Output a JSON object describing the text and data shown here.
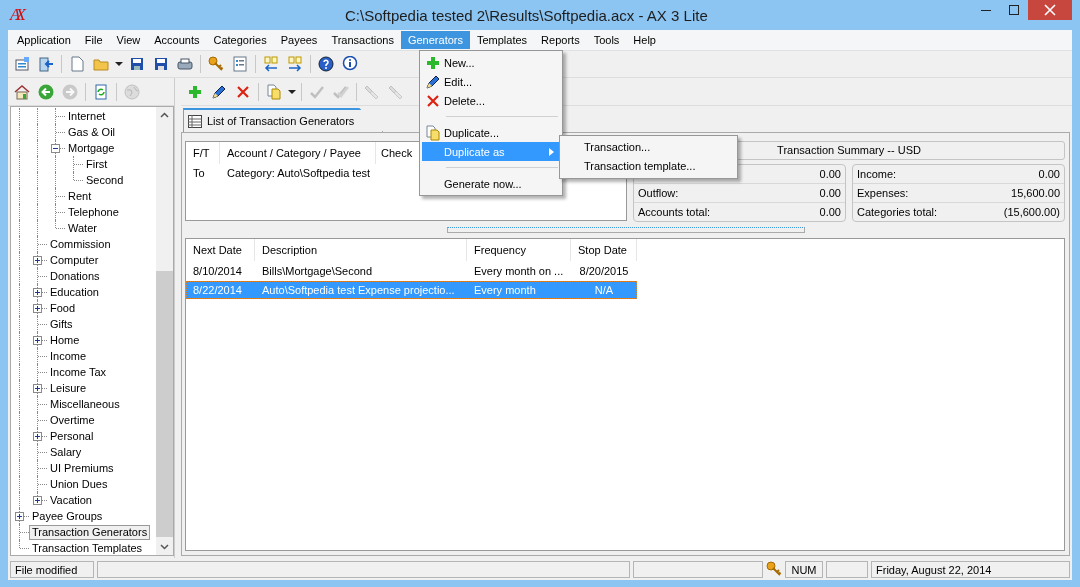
{
  "window": {
    "logo": "AX",
    "title": "C:\\Softpedia tested 2\\Results\\Softpedia.acx - AX 3 Lite"
  },
  "menu_bar": [
    {
      "label": "Application",
      "selected": false
    },
    {
      "label": "File",
      "selected": false
    },
    {
      "label": "View",
      "selected": false
    },
    {
      "label": "Accounts",
      "selected": false
    },
    {
      "label": "Categories",
      "selected": false
    },
    {
      "label": "Payees",
      "selected": false
    },
    {
      "label": "Transactions",
      "selected": false
    },
    {
      "label": "Generators",
      "selected": true
    },
    {
      "label": "Templates",
      "selected": false
    },
    {
      "label": "Reports",
      "selected": false
    },
    {
      "label": "Tools",
      "selected": false
    },
    {
      "label": "Help",
      "selected": false
    }
  ],
  "main_toolbar": [
    {
      "kind": "properties",
      "disabled": false
    },
    {
      "kind": "exit",
      "disabled": false
    },
    {
      "kind": "sep"
    },
    {
      "kind": "new",
      "disabled": false
    },
    {
      "kind": "open",
      "disabled": false
    },
    {
      "kind": "dropdown",
      "disabled": false
    },
    {
      "kind": "save",
      "disabled": false
    },
    {
      "kind": "saveas",
      "disabled": false
    },
    {
      "kind": "print",
      "disabled": false
    },
    {
      "kind": "sep"
    },
    {
      "kind": "key",
      "disabled": false
    },
    {
      "kind": "list",
      "disabled": false
    },
    {
      "kind": "sep"
    },
    {
      "kind": "moveleft",
      "disabled": false
    },
    {
      "kind": "moveright",
      "disabled": false
    },
    {
      "kind": "sep"
    },
    {
      "kind": "help",
      "disabled": false
    },
    {
      "kind": "info",
      "disabled": false
    }
  ],
  "nav_toolbar": [
    {
      "kind": "home",
      "disabled": false
    },
    {
      "kind": "back",
      "disabled": false
    },
    {
      "kind": "forward",
      "disabled": true
    },
    {
      "kind": "sep"
    },
    {
      "kind": "refresh",
      "disabled": false
    },
    {
      "kind": "sep"
    },
    {
      "kind": "globe",
      "disabled": true
    }
  ],
  "edit_toolbar": [
    {
      "kind": "add",
      "disabled": false
    },
    {
      "kind": "edit",
      "disabled": false
    },
    {
      "kind": "delete",
      "disabled": false
    },
    {
      "kind": "sep"
    },
    {
      "kind": "duplicate",
      "disabled": false
    },
    {
      "kind": "dropdown",
      "disabled": false
    },
    {
      "kind": "sep"
    },
    {
      "kind": "check",
      "disabled": true
    },
    {
      "kind": "checkall",
      "disabled": true
    },
    {
      "kind": "sep"
    },
    {
      "kind": "pin",
      "disabled": true
    },
    {
      "kind": "pin",
      "disabled": true
    }
  ],
  "tree": [
    {
      "children": [
        {
          "children": [
            {
              "label": "Internet",
              "selected": false
            },
            {
              "label": "Gas & Oil",
              "selected": false
            },
            {
              "label": "Mortgage",
              "selected": false,
              "expanded": true,
              "children": [
                {
                  "label": "First",
                  "selected": false
                },
                {
                  "label": "Second",
                  "selected": false
                }
              ]
            },
            {
              "label": "Rent",
              "selected": false
            },
            {
              "label": "Telephone",
              "selected": false
            },
            {
              "label": "Water",
              "selected": false
            }
          ]
        },
        {
          "label": "Commission",
          "selected": false
        },
        {
          "label": "Computer",
          "selected": false,
          "expanded": false
        },
        {
          "label": "Donations",
          "selected": false
        },
        {
          "label": "Education",
          "selected": false,
          "expanded": false
        },
        {
          "label": "Food",
          "selected": false,
          "expanded": false
        },
        {
          "label": "Gifts",
          "selected": false
        },
        {
          "label": "Home",
          "selected": false,
          "expanded": false
        },
        {
          "label": "Income",
          "selected": false
        },
        {
          "label": "Income Tax",
          "selected": false
        },
        {
          "label": "Leisure",
          "selected": false,
          "expanded": false
        },
        {
          "label": "Miscellaneous",
          "selected": false
        },
        {
          "label": "Overtime",
          "selected": false
        },
        {
          "label": "Personal",
          "selected": false,
          "expanded": false
        },
        {
          "label": "Salary",
          "selected": false
        },
        {
          "label": "UI Premiums",
          "selected": false
        },
        {
          "label": "Union Dues",
          "selected": false
        },
        {
          "label": "Vacation",
          "selected": false,
          "expanded": false
        }
      ]
    },
    {
      "label": "Payee Groups",
      "selected": false,
      "expanded": false
    },
    {
      "label": "Transaction Generators",
      "selected": true
    },
    {
      "label": "Transaction Templates",
      "selected": false
    }
  ],
  "tab": {
    "label": "List of Transaction Generators",
    "selected": true
  },
  "split_table": {
    "columns": [
      "F/T",
      "Account / Category / Payee",
      "Check"
    ],
    "rows": [
      {
        "ft": "To",
        "account": "Category: Auto\\Softpedia test"
      }
    ]
  },
  "summary": {
    "title": "Transaction Summary -- USD",
    "accounts": [
      {
        "value": "0.00"
      },
      {
        "label": "Outflow:",
        "value": "0.00"
      },
      {
        "label": "Accounts total:",
        "value": "0.00"
      }
    ],
    "categories": [
      {
        "label": "Income:",
        "value": "0.00"
      },
      {
        "label": "Expenses:",
        "value": "15,600.00"
      },
      {
        "label": "Categories total:",
        "value": "(15,600.00)"
      }
    ]
  },
  "generators_table": {
    "columns": [
      "Next Date",
      "Description",
      "Frequency",
      "Stop Date"
    ],
    "rows": [
      {
        "next_date": "8/10/2014",
        "description": "Bills\\Mortgage\\Second",
        "frequency": "Every month on ...",
        "stop_date": "8/20/2015",
        "selected": false
      },
      {
        "next_date": "8/22/2014",
        "description": "Auto\\Softpedia test Expense projectio...",
        "frequency": "Every month",
        "stop_date": "N/A",
        "selected": true
      }
    ]
  },
  "generators_menu": [
    {
      "kind": "item",
      "label": "New...",
      "selected": false
    },
    {
      "kind": "item",
      "label": "Edit...",
      "selected": false
    },
    {
      "kind": "item",
      "label": "Delete...",
      "selected": false
    },
    {
      "kind": "separator"
    },
    {
      "kind": "item",
      "label": "Duplicate...",
      "selected": false
    },
    {
      "kind": "submenu",
      "label": "Duplicate as",
      "selected": true
    },
    {
      "kind": "separator"
    },
    {
      "kind": "item",
      "label": "Generate now...",
      "selected": false
    }
  ],
  "submenu": [
    {
      "label": "Transaction...",
      "selected": false
    },
    {
      "label": "Transaction template...",
      "selected": false
    }
  ],
  "status_bar": {
    "message": "File modified",
    "num": "NUM",
    "date": "Friday, August 22, 2014"
  }
}
